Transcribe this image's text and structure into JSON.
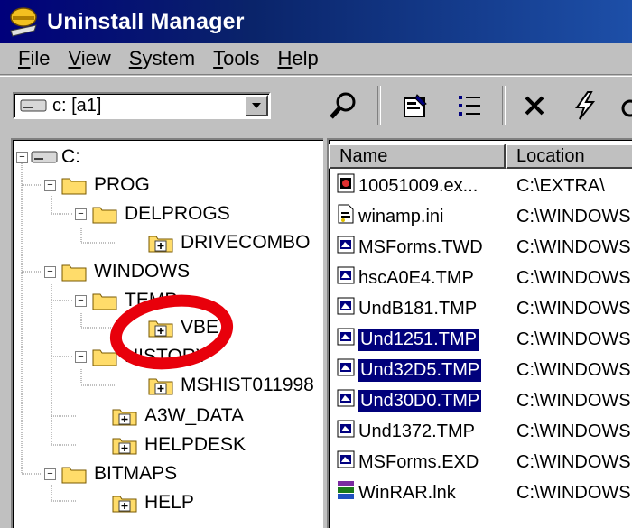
{
  "window": {
    "title": "Uninstall Manager"
  },
  "menu": [
    {
      "pre": "",
      "mn": "F",
      "post": "ile"
    },
    {
      "pre": "",
      "mn": "V",
      "post": "iew"
    },
    {
      "pre": "",
      "mn": "S",
      "post": "ystem"
    },
    {
      "pre": "",
      "mn": "T",
      "post": "ools"
    },
    {
      "pre": "",
      "mn": "H",
      "post": "elp"
    }
  ],
  "toolbar": {
    "drive_value": "c: [a1]",
    "buttons": [
      "find-icon",
      "properties-icon",
      "details-view-icon",
      "delete-icon",
      "lightning-icon"
    ]
  },
  "tree": {
    "nodes": [
      {
        "label": "C:",
        "kind": "drive",
        "expander": "-"
      },
      {
        "label": "PROG",
        "kind": "folder",
        "expander": "-"
      },
      {
        "label": "DELPROGS",
        "kind": "folder",
        "expander": "-"
      },
      {
        "label": "DRIVECOMBO",
        "kind": "folder-plus"
      },
      {
        "label": "WINDOWS",
        "kind": "folder",
        "expander": "-"
      },
      {
        "label": "TEMP",
        "kind": "folder",
        "expander": "-"
      },
      {
        "label": "VBE",
        "kind": "folder-plus"
      },
      {
        "label": "HISTORY",
        "kind": "folder",
        "expander": "-"
      },
      {
        "label": "MSHIST011998",
        "kind": "folder-plus"
      },
      {
        "label": "A3W_DATA",
        "kind": "folder-plus"
      },
      {
        "label": "HELPDESK",
        "kind": "folder-plus"
      },
      {
        "label": "BITMAPS",
        "kind": "folder",
        "expander": "-"
      },
      {
        "label": "HELP",
        "kind": "folder-plus"
      }
    ]
  },
  "list": {
    "columns": [
      "Name",
      "Location"
    ],
    "rows": [
      {
        "name": "10051009.ex...",
        "location": "C:\\EXTRA\\",
        "icon": "exe-icon",
        "selected": false
      },
      {
        "name": "winamp.ini",
        "location": "C:\\WINDOWS",
        "icon": "ini-icon",
        "selected": false
      },
      {
        "name": "MSForms.TWD",
        "location": "C:\\WINDOWS",
        "icon": "tmp-icon",
        "selected": false
      },
      {
        "name": "hscA0E4.TMP",
        "location": "C:\\WINDOWS",
        "icon": "tmp-icon",
        "selected": false
      },
      {
        "name": "UndB181.TMP",
        "location": "C:\\WINDOWS",
        "icon": "tmp-icon",
        "selected": false
      },
      {
        "name": "Und1251.TMP",
        "location": "C:\\WINDOWS",
        "icon": "tmp-icon",
        "selected": true
      },
      {
        "name": "Und32D5.TMP",
        "location": "C:\\WINDOWS",
        "icon": "tmp-icon",
        "selected": true
      },
      {
        "name": "Und30D0.TMP",
        "location": "C:\\WINDOWS",
        "icon": "tmp-icon",
        "selected": true
      },
      {
        "name": "Und1372.TMP",
        "location": "C:\\WINDOWS",
        "icon": "tmp-icon",
        "selected": false
      },
      {
        "name": "MSForms.EXD",
        "location": "C:\\WINDOWS",
        "icon": "tmp-icon",
        "selected": false
      },
      {
        "name": "WinRAR.lnk",
        "location": "C:\\WINDOWS",
        "icon": "winrar-icon",
        "selected": false
      }
    ]
  },
  "colors": {
    "titlebar": "#0a246a",
    "window_bg": "#c0c0c0",
    "selection": "#00007b",
    "folder": "#ffdc6a",
    "annotation": "#e8000b"
  }
}
